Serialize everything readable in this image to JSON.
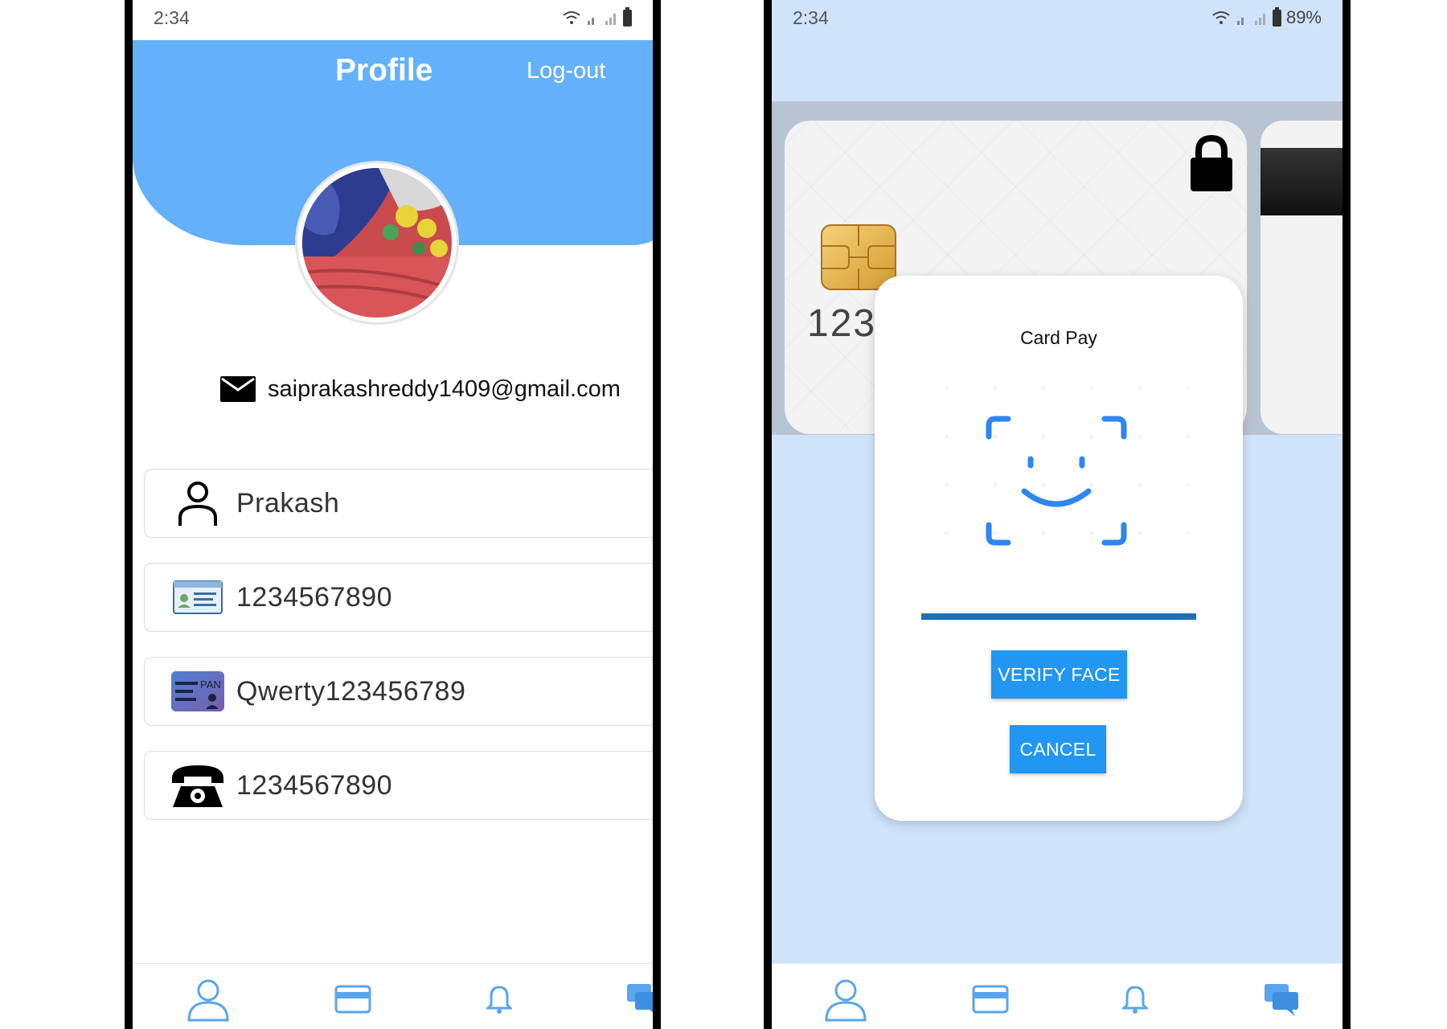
{
  "left_screen": {
    "status": {
      "time": "2:34"
    },
    "header": {
      "title": "Profile",
      "logout_label": "Log-out"
    },
    "email": "saiprakashreddy1409@gmail.com",
    "fields": [
      {
        "icon": "person-icon",
        "value": "Prakash"
      },
      {
        "icon": "id-card-icon",
        "value": "1234567890"
      },
      {
        "icon": "pan-card-icon",
        "value": "Qwerty123456789"
      },
      {
        "icon": "telephone-icon",
        "value": "1234567890"
      }
    ],
    "pan_icon_text": "PAN"
  },
  "right_screen": {
    "status": {
      "time": "2:34",
      "battery": "89%"
    },
    "card": {
      "number_partial": "123"
    },
    "dialog": {
      "title": "Card Pay",
      "verify_label": "VERIFY FACE",
      "cancel_label": "CANCEL"
    }
  },
  "bottom_nav": [
    "profile-nav-icon",
    "card-nav-icon",
    "notifications-nav-icon",
    "chat-nav-icon"
  ],
  "colors": {
    "header_blue": "#64b0fa",
    "accent_blue": "#2196f3",
    "right_background": "#cfe4fb"
  }
}
